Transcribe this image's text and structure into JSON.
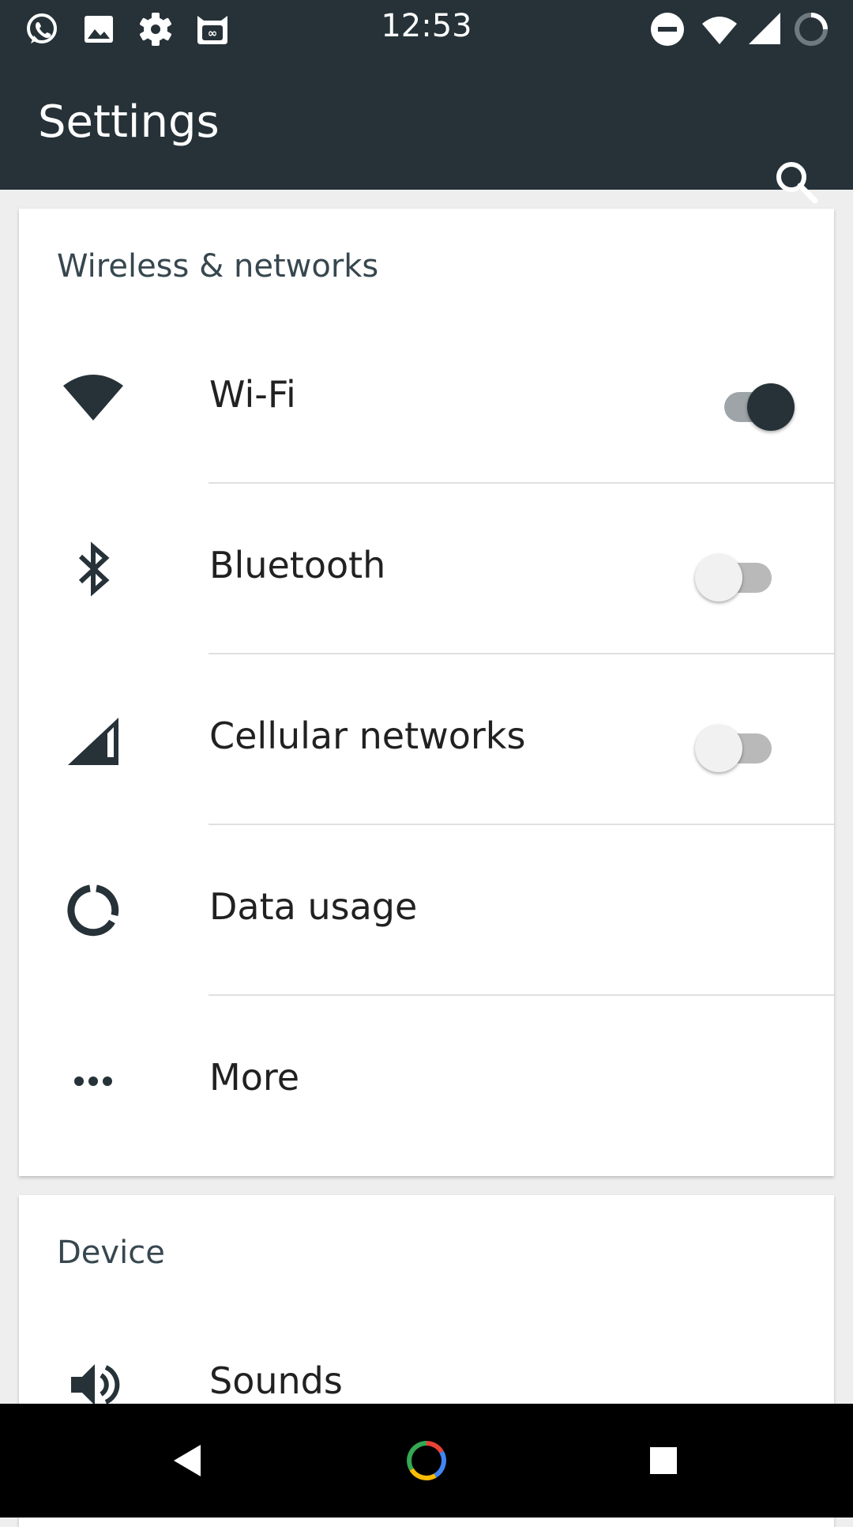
{
  "status_bar": {
    "time": "12:53",
    "left_icons": [
      "whatsapp-icon",
      "image-icon",
      "gear-icon",
      "cat-app-icon"
    ],
    "right_icons": [
      "do-not-disturb-icon",
      "wifi-icon",
      "signal-icon",
      "battery-icon"
    ]
  },
  "app_bar": {
    "title": "Settings",
    "search_icon": "search-icon"
  },
  "sections": [
    {
      "header": "Wireless & networks",
      "items": [
        {
          "label": "Wi-Fi",
          "icon": "wifi-icon",
          "toggle": true,
          "on": true
        },
        {
          "label": "Bluetooth",
          "icon": "bluetooth-icon",
          "toggle": true,
          "on": false
        },
        {
          "label": "Cellular networks",
          "icon": "cellular-signal-icon",
          "toggle": true,
          "on": false
        },
        {
          "label": "Data usage",
          "icon": "data-usage-icon"
        },
        {
          "label": "More",
          "icon": "more-dots-icon"
        }
      ]
    },
    {
      "header": "Device",
      "items": [
        {
          "label": "Sounds",
          "icon": "volume-icon"
        }
      ]
    }
  ],
  "nav_bar": {
    "buttons": [
      "back-icon",
      "home-icon",
      "recents-icon"
    ]
  },
  "colors": {
    "app_bar": "#263238",
    "toggle_on_thumb": "#263238",
    "toggle_on_track": "#9ea4a7",
    "toggle_off_thumb": "#f1f1f1",
    "toggle_off_track": "#b9b9b9",
    "divider": "#e0e0e0"
  }
}
